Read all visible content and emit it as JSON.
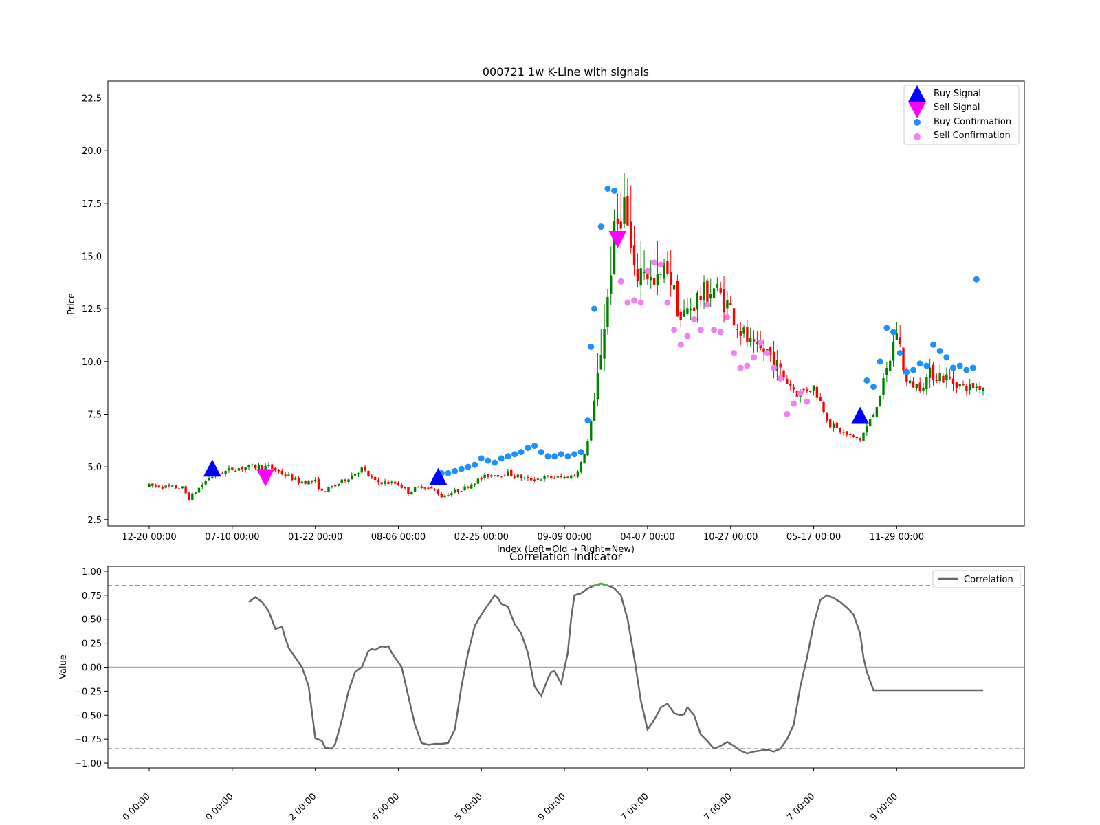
{
  "chart_data": [
    {
      "type": "candlestick",
      "title": "000721 1w K-Line with signals",
      "xlabel": "Index (Left=Old → Right=New)",
      "ylabel": "Price",
      "ylim": [
        2.2,
        23.3
      ],
      "yticks": [
        "2.5",
        "5.0",
        "7.5",
        "10.0",
        "12.5",
        "15.0",
        "17.5",
        "20.0",
        "22.5"
      ],
      "xticks": [
        "12-20 00:00",
        "07-10 00:00",
        "01-22 00:00",
        "08-06 00:00",
        "02-25 00:00",
        "09-09 00:00",
        "04-07 00:00",
        "10-27 00:00",
        "05-17 00:00",
        "11-29 00:00"
      ],
      "xtick_index": [
        0,
        25,
        50,
        75,
        100,
        125,
        150,
        175,
        200,
        225
      ],
      "bars": 252,
      "price_path": [
        [
          0,
          4.1
        ],
        [
          10,
          4.0
        ],
        [
          12,
          3.5
        ],
        [
          18,
          4.5
        ],
        [
          25,
          4.9
        ],
        [
          30,
          5.0
        ],
        [
          36,
          5.0
        ],
        [
          40,
          4.7
        ],
        [
          45,
          4.3
        ],
        [
          50,
          4.3
        ],
        [
          52,
          3.8
        ],
        [
          58,
          4.3
        ],
        [
          62,
          4.7
        ],
        [
          64,
          4.9
        ],
        [
          68,
          4.3
        ],
        [
          75,
          4.2
        ],
        [
          78,
          3.8
        ],
        [
          82,
          4.1
        ],
        [
          86,
          3.9
        ],
        [
          88,
          3.6
        ],
        [
          95,
          4.0
        ],
        [
          98,
          4.3
        ],
        [
          102,
          4.6
        ],
        [
          108,
          4.7
        ],
        [
          114,
          4.4
        ],
        [
          120,
          4.5
        ],
        [
          125,
          4.5
        ],
        [
          128,
          4.6
        ],
        [
          131,
          5.5
        ],
        [
          134,
          8.0
        ],
        [
          136,
          10.5
        ],
        [
          138,
          13.0
        ],
        [
          140,
          16.0
        ],
        [
          143,
          17.5
        ],
        [
          146,
          14.0
        ],
        [
          149,
          14.5
        ],
        [
          152,
          13.5
        ],
        [
          156,
          14.5
        ],
        [
          160,
          12.0
        ],
        [
          165,
          13.0
        ],
        [
          170,
          13.5
        ],
        [
          175,
          12.5
        ],
        [
          178,
          11.5
        ],
        [
          182,
          10.5
        ],
        [
          186,
          10.5
        ],
        [
          190,
          9.5
        ],
        [
          195,
          8.5
        ],
        [
          200,
          8.8
        ],
        [
          205,
          7.0
        ],
        [
          210,
          6.5
        ],
        [
          214,
          6.3
        ],
        [
          218,
          7.5
        ],
        [
          222,
          9.5
        ],
        [
          225,
          11.5
        ],
        [
          228,
          9.0
        ],
        [
          232,
          8.8
        ],
        [
          236,
          9.5
        ],
        [
          240,
          9.2
        ],
        [
          245,
          8.8
        ],
        [
          250,
          8.8
        ],
        [
          251,
          8.8
        ]
      ],
      "buy_signals": [
        [
          19,
          4.9
        ],
        [
          87,
          4.5
        ],
        [
          214,
          7.4
        ]
      ],
      "sell_signals": [
        [
          35,
          4.5
        ],
        [
          141,
          15.8
        ]
      ],
      "buy_confirmations": [
        [
          88,
          4.7
        ],
        [
          90,
          4.7
        ],
        [
          92,
          4.8
        ],
        [
          94,
          4.9
        ],
        [
          96,
          5.0
        ],
        [
          98,
          5.1
        ],
        [
          100,
          5.4
        ],
        [
          102,
          5.3
        ],
        [
          104,
          5.2
        ],
        [
          106,
          5.4
        ],
        [
          108,
          5.5
        ],
        [
          110,
          5.6
        ],
        [
          112,
          5.7
        ],
        [
          114,
          5.9
        ],
        [
          116,
          6.0
        ],
        [
          118,
          5.7
        ],
        [
          120,
          5.5
        ],
        [
          122,
          5.5
        ],
        [
          124,
          5.6
        ],
        [
          126,
          5.5
        ],
        [
          128,
          5.6
        ],
        [
          130,
          5.7
        ],
        [
          132,
          7.2
        ],
        [
          133,
          10.7
        ],
        [
          134,
          12.5
        ],
        [
          136,
          16.4
        ],
        [
          138,
          18.2
        ],
        [
          140,
          18.1
        ],
        [
          214,
          7.3
        ],
        [
          216,
          9.1
        ],
        [
          218,
          8.8
        ],
        [
          220,
          10.0
        ],
        [
          222,
          11.6
        ],
        [
          224,
          11.4
        ],
        [
          226,
          10.4
        ],
        [
          228,
          9.5
        ],
        [
          230,
          9.6
        ],
        [
          232,
          9.9
        ],
        [
          234,
          9.8
        ],
        [
          236,
          10.8
        ],
        [
          238,
          10.5
        ],
        [
          240,
          10.2
        ],
        [
          242,
          9.7
        ],
        [
          244,
          9.8
        ],
        [
          246,
          9.6
        ],
        [
          248,
          9.7
        ],
        [
          249,
          13.9
        ]
      ],
      "sell_confirmations": [
        [
          142,
          13.8
        ],
        [
          144,
          12.8
        ],
        [
          146,
          12.9
        ],
        [
          148,
          12.8
        ],
        [
          150,
          14.3
        ],
        [
          152,
          14.7
        ],
        [
          154,
          14.6
        ],
        [
          156,
          12.8
        ],
        [
          158,
          11.5
        ],
        [
          160,
          10.8
        ],
        [
          162,
          11.2
        ],
        [
          164,
          12.0
        ],
        [
          166,
          11.5
        ],
        [
          168,
          12.7
        ],
        [
          170,
          11.5
        ],
        [
          172,
          11.4
        ],
        [
          174,
          12.1
        ],
        [
          176,
          10.4
        ],
        [
          178,
          9.7
        ],
        [
          180,
          9.8
        ],
        [
          182,
          10.2
        ],
        [
          184,
          10.9
        ],
        [
          186,
          10.4
        ],
        [
          188,
          9.7
        ],
        [
          190,
          9.2
        ],
        [
          192,
          7.5
        ],
        [
          194,
          8.0
        ],
        [
          196,
          8.5
        ],
        [
          198,
          8.1
        ]
      ],
      "legend": [
        "Buy Signal",
        "Sell Signal",
        "Buy Confirmation",
        "Sell Confirmation"
      ],
      "colors": {
        "up": "#008000",
        "down": "#ff0000",
        "buy_signal": "#0000ff",
        "sell_signal": "#ff00ff",
        "buy_conf": "#1e90ff",
        "sell_conf": "#ee82ee"
      }
    },
    {
      "type": "line",
      "title": "Correlation Indicator",
      "ylabel": "Value",
      "ylim": [
        -1.05,
        1.05
      ],
      "yticks": [
        "1.00",
        "0.75",
        "0.50",
        "0.25",
        "0.00",
        "−0.25",
        "−0.50",
        "−0.75",
        "−1.00"
      ],
      "xtick_index": [
        0,
        25,
        50,
        75,
        100,
        125,
        150,
        175,
        200,
        225
      ],
      "xticks_visible": [
        "0 00:00",
        "0 00:00",
        "2 00:00",
        "6 00:00",
        "5 00:00",
        "9 00:00",
        "7 00:00",
        "7 00:00",
        "7 00:00",
        "9 00:00"
      ],
      "thresholds": [
        0.85,
        -0.85
      ],
      "legend": [
        "Correlation"
      ],
      "series": [
        {
          "name": "Correlation",
          "x": [
            30,
            32,
            34,
            36,
            38,
            40,
            41,
            42,
            44,
            46,
            48,
            50,
            52,
            53,
            55,
            56,
            58,
            60,
            62,
            64,
            66,
            67,
            68,
            69,
            70,
            71,
            72,
            73,
            74,
            75,
            76,
            78,
            80,
            82,
            84,
            86,
            88,
            90,
            92,
            94,
            96,
            98,
            100,
            102,
            104,
            105,
            106,
            108,
            110,
            112,
            113,
            114,
            116,
            118,
            120,
            121,
            122,
            124,
            126,
            127,
            128,
            130,
            132,
            134,
            136,
            138,
            140,
            142,
            144,
            146,
            148,
            150,
            152,
            154,
            156,
            158,
            160,
            161,
            162,
            164,
            166,
            168,
            170,
            172,
            174,
            176,
            178,
            180,
            182,
            184,
            186,
            188,
            190,
            192,
            194,
            196,
            198,
            200,
            202,
            204,
            206,
            208,
            210,
            212,
            214,
            215,
            216,
            218,
            220,
            222,
            224,
            226,
            228,
            230,
            232,
            234,
            236,
            238,
            240,
            242,
            244,
            246,
            248,
            249,
            250,
            251
          ],
          "values": [
            0.68,
            0.73,
            0.68,
            0.58,
            0.4,
            0.42,
            0.3,
            0.2,
            0.1,
            0.0,
            -0.2,
            -0.74,
            -0.77,
            -0.84,
            -0.85,
            -0.8,
            -0.55,
            -0.25,
            -0.05,
            0.0,
            0.17,
            0.19,
            0.18,
            0.2,
            0.22,
            0.21,
            0.22,
            0.15,
            0.1,
            0.05,
            0.0,
            -0.3,
            -0.6,
            -0.79,
            -0.81,
            -0.8,
            -0.8,
            -0.79,
            -0.65,
            -0.2,
            0.15,
            0.43,
            0.55,
            0.65,
            0.75,
            0.72,
            0.66,
            0.63,
            0.45,
            0.35,
            0.25,
            0.15,
            -0.2,
            -0.3,
            -0.12,
            -0.05,
            -0.04,
            -0.17,
            0.15,
            0.5,
            0.75,
            0.77,
            0.82,
            0.85,
            0.87,
            0.85,
            0.82,
            0.75,
            0.5,
            0.1,
            -0.35,
            -0.65,
            -0.55,
            -0.42,
            -0.38,
            -0.48,
            -0.5,
            -0.49,
            -0.42,
            -0.5,
            -0.7,
            -0.77,
            -0.85,
            -0.82,
            -0.78,
            -0.82,
            -0.87,
            -0.9,
            -0.88,
            -0.87,
            -0.86,
            -0.88,
            -0.85,
            -0.75,
            -0.6,
            -0.2,
            0.1,
            0.45,
            0.7,
            0.75,
            0.72,
            0.68,
            0.62,
            0.55,
            0.35,
            0.1,
            -0.05,
            -0.24,
            -0.24,
            -0.24,
            -0.24,
            -0.24,
            -0.24,
            -0.24,
            -0.24,
            -0.24,
            -0.24,
            -0.24,
            -0.24,
            -0.24,
            -0.24,
            -0.24,
            -0.24,
            -0.24,
            -0.24,
            -0.24
          ]
        }
      ]
    }
  ]
}
